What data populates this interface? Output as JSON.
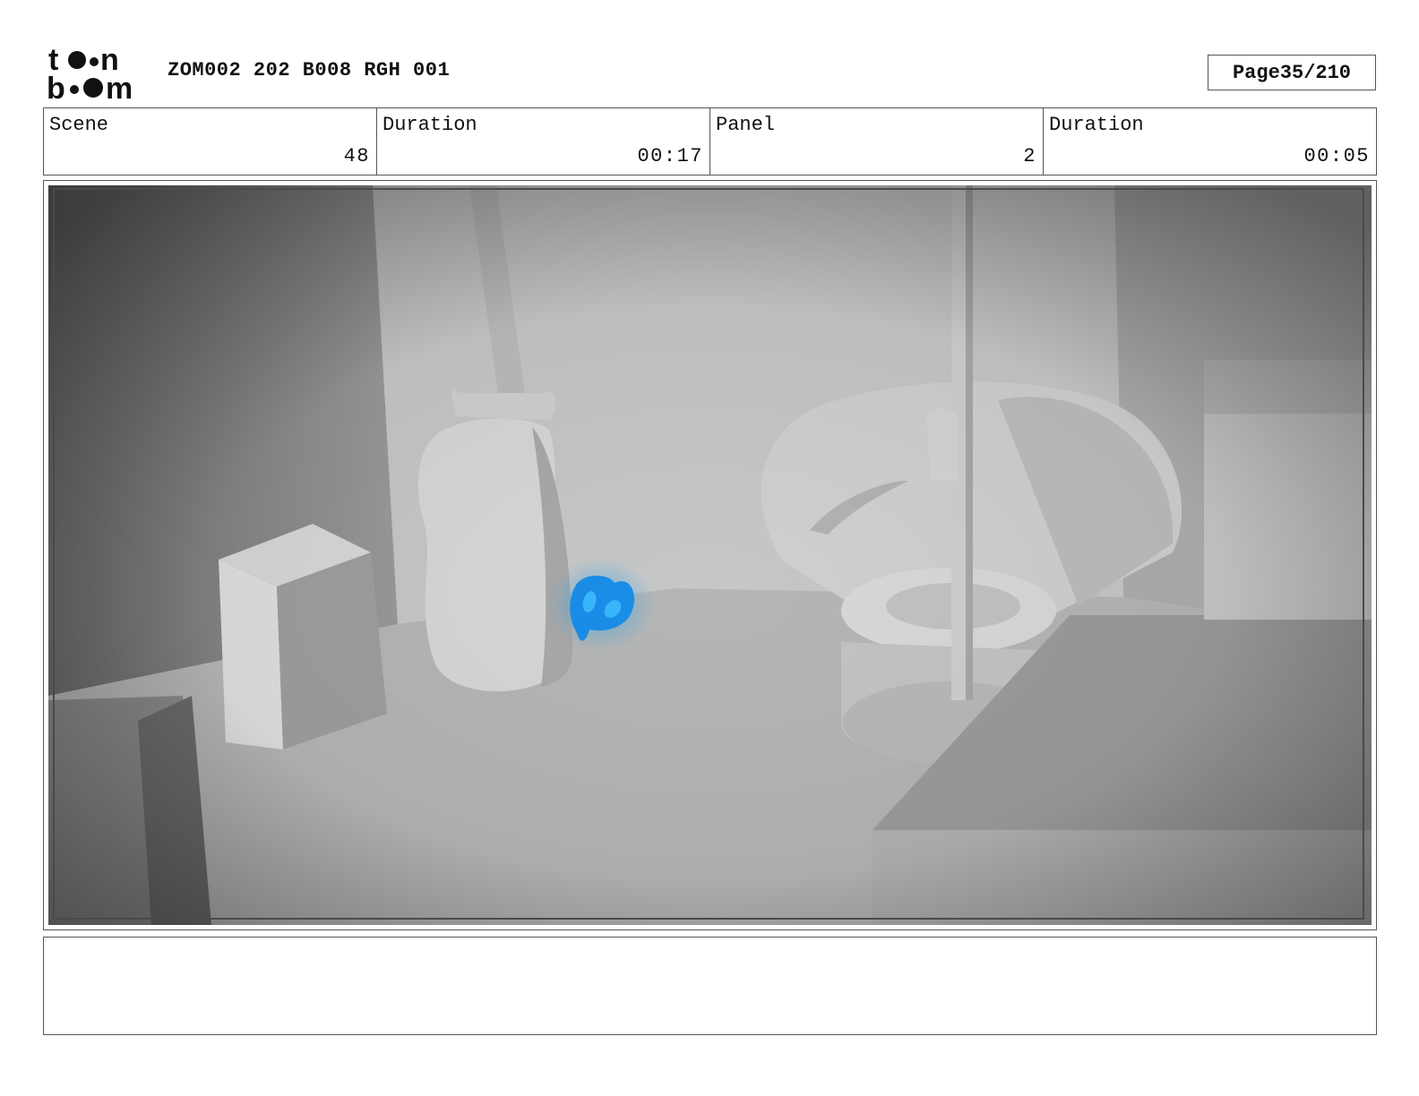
{
  "header": {
    "logo_text_top": "toon",
    "logo_text_bottom": "boom",
    "document_title": "ZOM002 202 B008 RGH 001",
    "page_label": "Page",
    "page_number": "35/210"
  },
  "info": {
    "scene_label": "Scene",
    "scene_value": "48",
    "scene_duration_label": "Duration",
    "scene_duration_value": "00:17",
    "panel_label": "Panel",
    "panel_value": "2",
    "panel_duration_label": "Duration",
    "panel_duration_value": "00:05"
  },
  "panel": {
    "accent_color": "#29a3f0",
    "icons": [
      "guitar-icon",
      "glowing-creature-icon",
      "speaker-icon",
      "tire-icon",
      "microphone-stand-icon"
    ]
  },
  "caption": {
    "text": ""
  }
}
